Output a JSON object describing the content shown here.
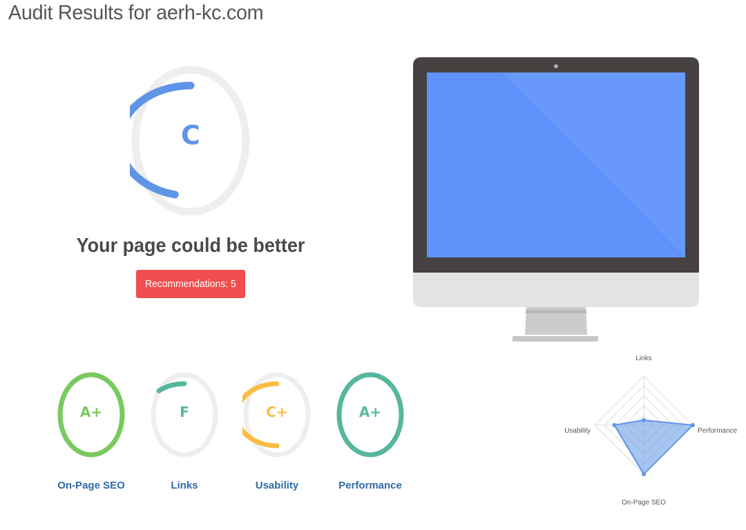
{
  "page": {
    "title": "Audit Results for aerh-kc.com"
  },
  "overall": {
    "grade": "C",
    "score_fraction": 0.46,
    "color": "#5f95e6",
    "track_color": "#eeeeee",
    "summary": "Your page could be better",
    "recommendations_label": "Recommendations: 5",
    "recommendations_color": "#f04e4e"
  },
  "monitor": {
    "screen_color": "#5f92fa",
    "bezel_color": "#444140",
    "chin_color": "#e3e3e3",
    "stand_color": "#c7c7c7"
  },
  "categories": [
    {
      "grade": "A+",
      "label": "On-Page SEO",
      "score_fraction": 1.0,
      "color": "#79c95e"
    },
    {
      "grade": "F",
      "label": "Links",
      "score_fraction": 0.12,
      "color": "#56b79e"
    },
    {
      "grade": "C+",
      "label": "Usability",
      "score_fraction": 0.5,
      "color": "#f9bd44"
    },
    {
      "grade": "A+",
      "label": "Performance",
      "score_fraction": 1.0,
      "color": "#56b79e"
    }
  ],
  "radar": {
    "axes": [
      "Links",
      "Performance",
      "On-Page SEO",
      "Usability"
    ],
    "values": [
      0.1,
      1.0,
      1.0,
      0.6
    ],
    "max": 1.0,
    "fill_color": "#5f95e6",
    "grid_color": "#dddddd"
  }
}
